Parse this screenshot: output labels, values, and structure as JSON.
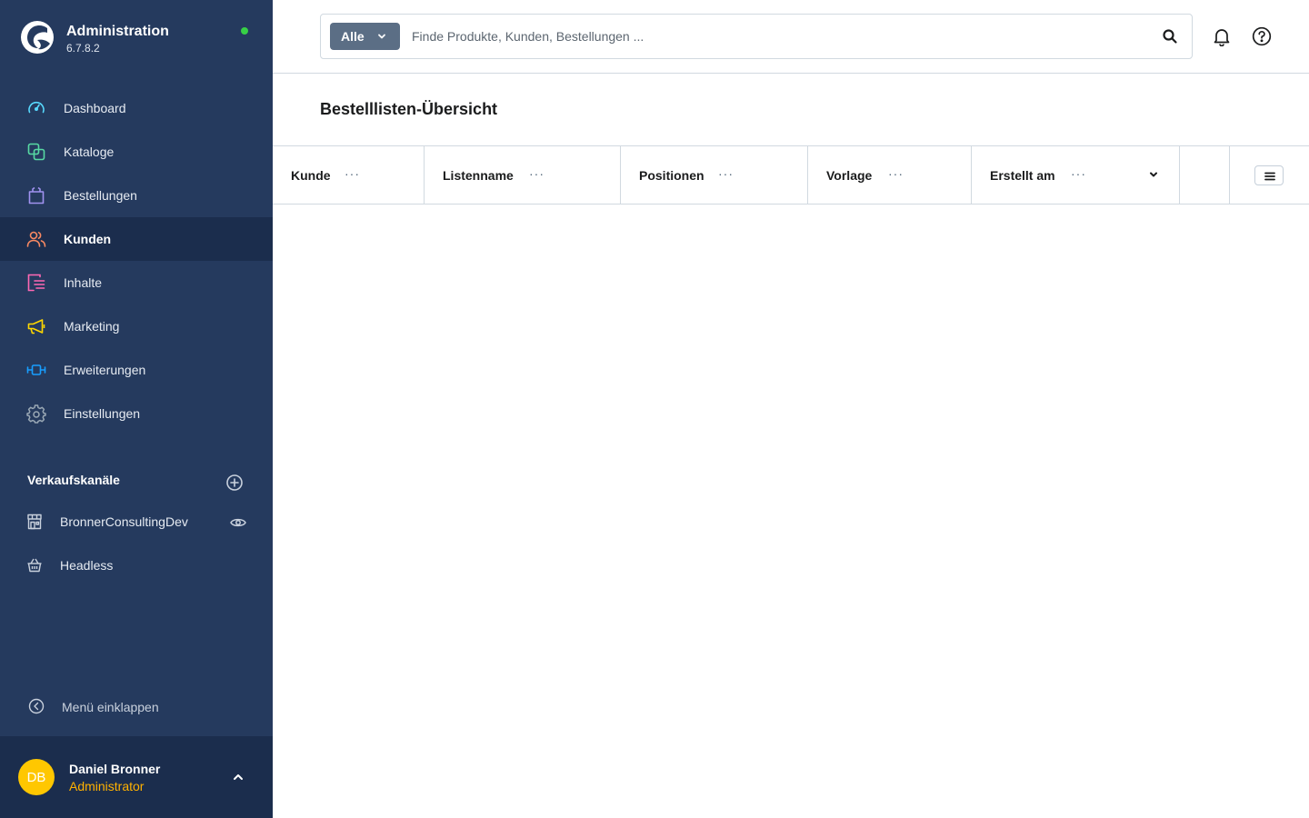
{
  "app": {
    "title": "Administration",
    "version": "6.7.8.2",
    "status_color": "#37d046",
    "logo_icon": "shopware-logo"
  },
  "sidebar": {
    "background": "#253a5e",
    "items": [
      {
        "label": "Dashboard",
        "icon": "gauge-icon",
        "color": "#57d9ff",
        "active": false
      },
      {
        "label": "Kataloge",
        "icon": "catalog-icon",
        "color": "#57d9a3",
        "active": false
      },
      {
        "label": "Bestellungen",
        "icon": "shopping-bag-icon",
        "color": "#a092f0",
        "active": false
      },
      {
        "label": "Kunden",
        "icon": "users-icon",
        "color": "#f88962",
        "active": true
      },
      {
        "label": "Inhalte",
        "icon": "content-icon",
        "color": "#ff68b4",
        "active": false
      },
      {
        "label": "Marketing",
        "icon": "megaphone-icon",
        "color": "#ffd700",
        "active": false
      },
      {
        "label": "Erweiterungen",
        "icon": "plugin-icon",
        "color": "#189eff",
        "active": false
      },
      {
        "label": "Einstellungen",
        "icon": "gear-icon",
        "color": "#9aa8b5",
        "active": false
      }
    ],
    "sales_channels": {
      "title": "Verkaufskanäle",
      "items": [
        {
          "label": "BronnerConsultingDev",
          "icon": "storefront-icon"
        },
        {
          "label": "Headless",
          "icon": "basket-icon"
        }
      ]
    },
    "collapse_label": "Menü einklappen",
    "user": {
      "initials": "DB",
      "name": "Daniel Bronner",
      "role": "Administrator",
      "avatar_color": "#ffc700",
      "role_color": "#ffb100"
    }
  },
  "search": {
    "type_label": "Alle",
    "placeholder": "Finde Produkte, Kunden, Bestellungen ...",
    "value": ""
  },
  "page": {
    "title": "Bestelllisten-Übersicht"
  },
  "grid": {
    "columns": [
      {
        "label": "Kunde"
      },
      {
        "label": "Listenname"
      },
      {
        "label": "Positionen"
      },
      {
        "label": "Vorlage"
      },
      {
        "label": "Erstellt am",
        "sorted": "desc"
      }
    ],
    "rows": []
  }
}
